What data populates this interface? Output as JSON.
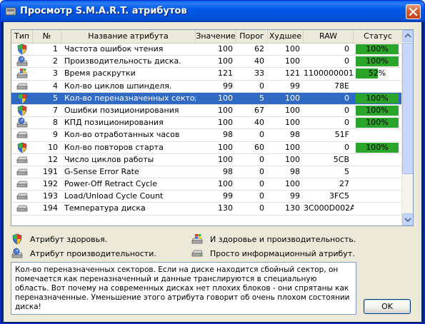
{
  "window": {
    "title": "Просмотр S.M.A.R.T. атрибутов"
  },
  "columns": {
    "type": "Тип",
    "num": "№",
    "name": "Название атрибута",
    "value": "Значение",
    "threshold": "Порог",
    "worst": "Худшее",
    "raw": "RAW",
    "status": "Статус"
  },
  "rows": [
    {
      "icon": "shield-icon",
      "num": "1",
      "name": "Частота ошибок чтения",
      "value": "100",
      "threshold": "62",
      "worst": "100",
      "raw": "0",
      "status": "100%",
      "status_pct": 100
    },
    {
      "icon": "hdd-gauge-icon",
      "num": "2",
      "name": "Производительность диска.",
      "value": "100",
      "threshold": "40",
      "worst": "100",
      "raw": "0",
      "status": "100%",
      "status_pct": 100
    },
    {
      "icon": "hdd-windows-icon",
      "num": "3",
      "name": "Время раскрутки",
      "value": "121",
      "threshold": "33",
      "worst": "121",
      "raw": "1100000001",
      "status": "52%",
      "status_pct": 52
    },
    {
      "icon": "hdd-icon",
      "num": "4",
      "name": "Кол-во циклов шпинделя.",
      "value": "99",
      "threshold": "0",
      "worst": "99",
      "raw": "78E",
      "status": "",
      "status_pct": null
    },
    {
      "icon": "shield-icon",
      "num": "5",
      "name": "Кол-во переназначенных секторов",
      "value": "100",
      "threshold": "5",
      "worst": "100",
      "raw": "0",
      "status": "100%",
      "status_pct": 100,
      "selected": true
    },
    {
      "icon": "shield-icon",
      "num": "7",
      "name": "Ошибки позиционирования",
      "value": "100",
      "threshold": "67",
      "worst": "100",
      "raw": "0",
      "status": "100%",
      "status_pct": 100
    },
    {
      "icon": "hdd-gauge-icon",
      "num": "8",
      "name": "КПД позиционирования",
      "value": "100",
      "threshold": "40",
      "worst": "100",
      "raw": "0",
      "status": "100%",
      "status_pct": 100
    },
    {
      "icon": "hdd-icon",
      "num": "9",
      "name": "Кол-во отработанных часов",
      "value": "98",
      "threshold": "0",
      "worst": "98",
      "raw": "51F",
      "status": "",
      "status_pct": null
    },
    {
      "icon": "shield-icon",
      "num": "10",
      "name": "Кол-во повторов старта",
      "value": "100",
      "threshold": "60",
      "worst": "100",
      "raw": "0",
      "status": "100%",
      "status_pct": 100
    },
    {
      "icon": "hdd-icon",
      "num": "12",
      "name": "Число циклов работы",
      "value": "100",
      "threshold": "0",
      "worst": "100",
      "raw": "5CB",
      "status": "",
      "status_pct": null
    },
    {
      "icon": "hdd-icon",
      "num": "191",
      "name": "G-Sense Error Rate",
      "value": "98",
      "threshold": "0",
      "worst": "98",
      "raw": "5",
      "status": "",
      "status_pct": null
    },
    {
      "icon": "hdd-icon",
      "num": "192",
      "name": "Power-Off Retract Cycle",
      "value": "100",
      "threshold": "0",
      "worst": "100",
      "raw": "27",
      "status": "",
      "status_pct": null
    },
    {
      "icon": "hdd-icon",
      "num": "193",
      "name": "Load/Unload Cycle Count",
      "value": "99",
      "threshold": "0",
      "worst": "99",
      "raw": "3FC5",
      "status": "",
      "status_pct": null
    },
    {
      "icon": "hdd-icon",
      "num": "194",
      "name": "Температура диска",
      "value": "130",
      "threshold": "0",
      "worst": "130",
      "raw": "3C000D002A",
      "status": "",
      "status_pct": null
    }
  ],
  "legend": {
    "health": "Атрибут здоровья.",
    "performance": "Атрибут производительности.",
    "both": "И здоровье и производительность.",
    "info": "Просто информационный атрибут."
  },
  "description": "Кол-во переназначенных секторов. Если на диске находится сбойный сектор, он помечается как переназначенный и данные транслируются в специальную область. Вот почему на современных дисках нет плохих блоков - они спрятаны как переназначенные. Уменьшение этого атрибута говорит об очень плохом состоянии диска!",
  "ok_label": "OK",
  "colors": {
    "selection": "#316ac5",
    "status_bar": "#2aa52a",
    "titlebar": "#0058e6"
  }
}
